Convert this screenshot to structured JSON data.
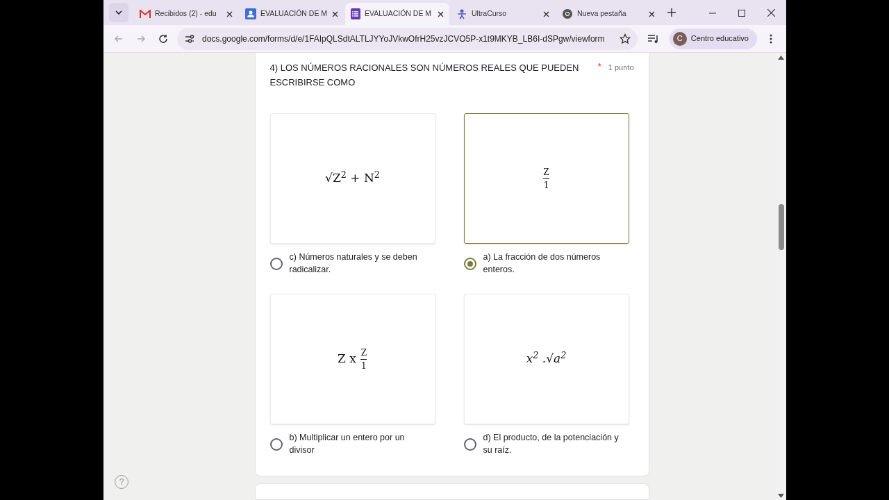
{
  "tabs": [
    {
      "title": "Recibidos (2) - edu",
      "kind": "mail",
      "selected": false
    },
    {
      "title": "EVALUACIÓN DE M",
      "kind": "person",
      "selected": false
    },
    {
      "title": "EVALUACIÓN DE M",
      "kind": "forms",
      "selected": true
    },
    {
      "title": "UltraCurso",
      "kind": "figure",
      "selected": false
    },
    {
      "title": "Nueva pestaña",
      "kind": "globe",
      "selected": false
    }
  ],
  "address_bar": {
    "url": "docs.google.com/forms/d/e/1FAIpQLSdtALTLJYYoJVkwOfrH25vzJCVO5P-x1t9MKYB_LB6I-dSPgw/viewform"
  },
  "profile": {
    "initial": "C",
    "name": "Centro educativo"
  },
  "question": {
    "title": "4) LOS NÚMEROS RACIONALES SON NÚMEROS REALES QUE PUEDEN ESCRIBIRSE COMO",
    "required_mark": "*",
    "points": "1 punto",
    "options": [
      {
        "label": "c) Números naturales y se deben radicalizar.",
        "selected": false,
        "formula": {
          "kind": "text",
          "text": "√Z$^{2}$ + N$^{2}$",
          "italic": false
        }
      },
      {
        "label": "a) La fracción de dos números enteros.",
        "selected": true,
        "formula": {
          "kind": "fraction",
          "numerator": "Z",
          "denominator": "1"
        }
      },
      {
        "label": "b) Multiplicar un entero por un divisor",
        "selected": false,
        "formula": {
          "kind": "fraction",
          "prefix": "Z x",
          "numerator": "Z",
          "denominator": "1"
        }
      },
      {
        "label": "d) El producto, de la potenciación y su raíz.",
        "selected": false,
        "formula": {
          "kind": "text",
          "text": "x$^{2}$ .√a$^{2}$",
          "italic": true
        }
      }
    ]
  },
  "help": {
    "symbol": "?"
  }
}
